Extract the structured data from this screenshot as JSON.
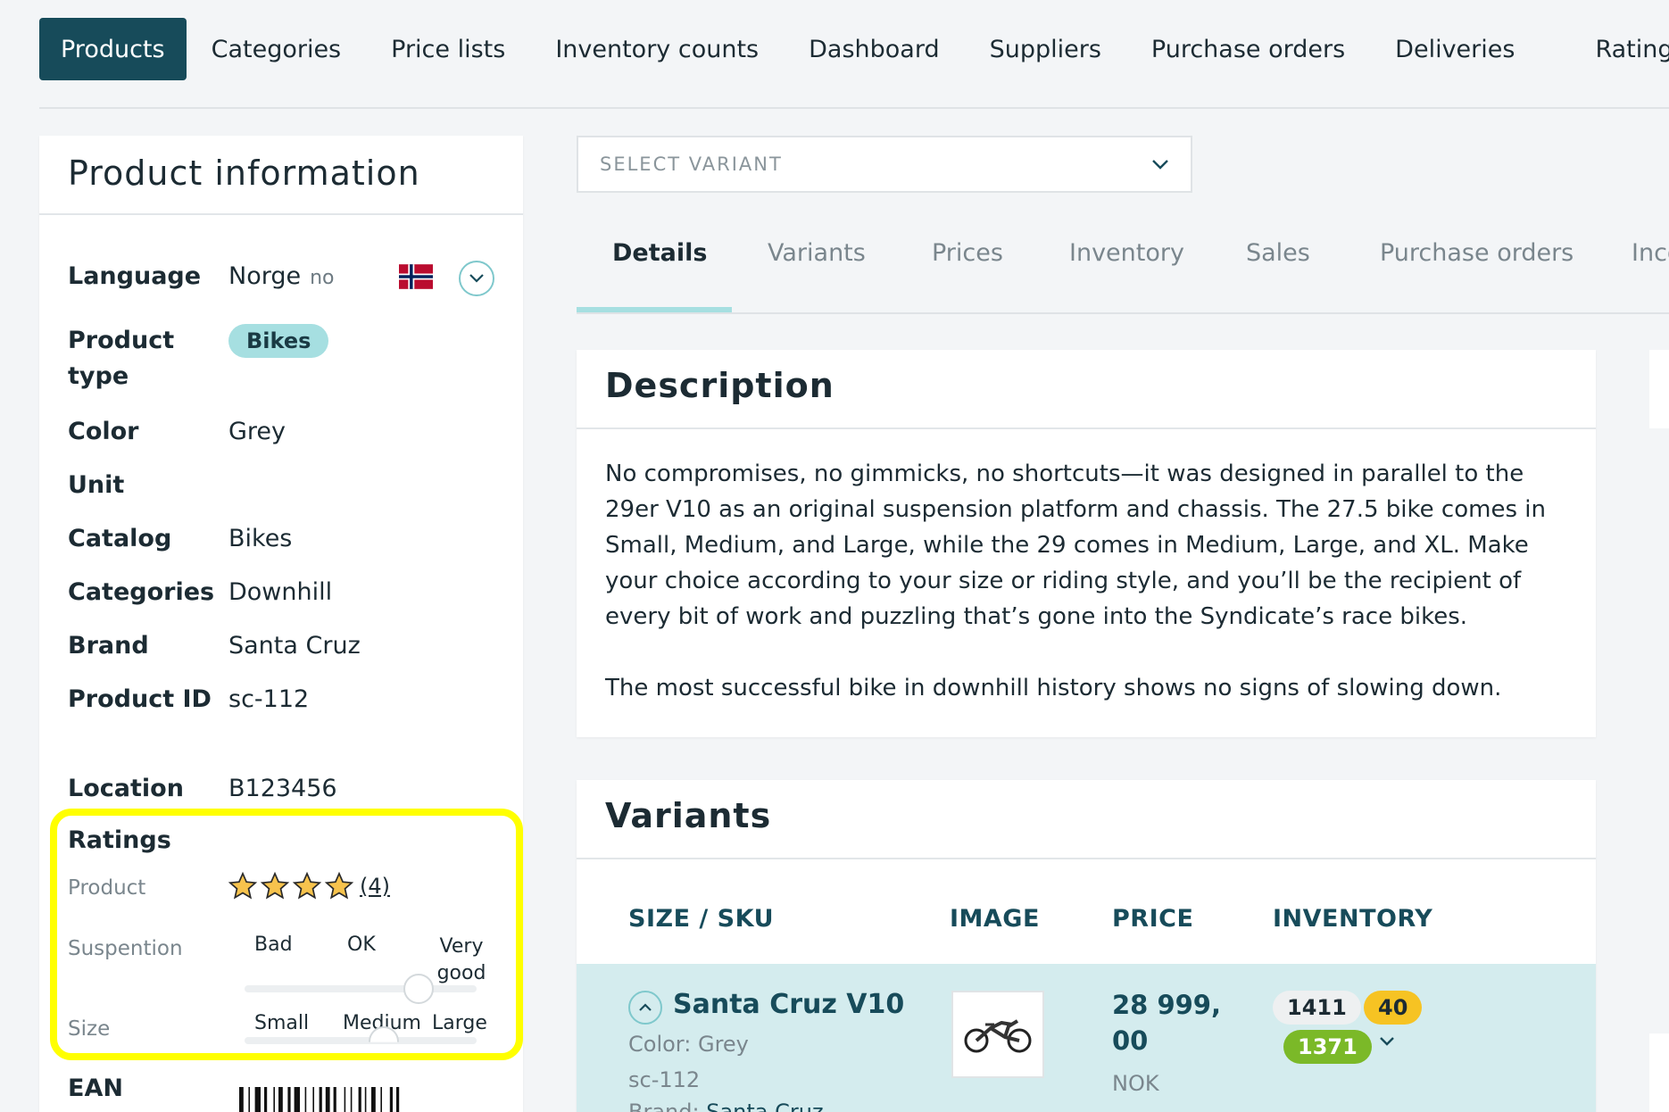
{
  "nav": {
    "items": [
      "Products",
      "Categories",
      "Price lists",
      "Inventory counts",
      "Dashboard",
      "Suppliers",
      "Purchase orders",
      "Deliveries",
      "Ratings"
    ],
    "active": "Products"
  },
  "product_info": {
    "title": "Product information",
    "language": {
      "label": "Language",
      "value": "Norge",
      "code": "no"
    },
    "product_type": {
      "label": "Product type",
      "value": "Bikes"
    },
    "color": {
      "label": "Color",
      "value": "Grey"
    },
    "unit": {
      "label": "Unit",
      "value": ""
    },
    "catalog": {
      "label": "Catalog",
      "value": "Bikes"
    },
    "categories": {
      "label": "Categories",
      "value": "Downhill"
    },
    "brand": {
      "label": "Brand",
      "value": "Santa Cruz"
    },
    "product_id": {
      "label": "Product ID",
      "value": "sc-112"
    },
    "location": {
      "label": "Location",
      "value": "B123456"
    },
    "ratings": {
      "title": "Ratings",
      "product": {
        "label": "Product",
        "stars": 4,
        "count_text": "(4)"
      },
      "suspension": {
        "label": "Suspention",
        "scale": [
          "Bad",
          "OK",
          "Very good"
        ],
        "level": 0.75
      },
      "size": {
        "label": "Size",
        "scale": [
          "Small",
          "Medium",
          "Large"
        ],
        "level": 0.6
      }
    },
    "ean": {
      "label": "EAN"
    }
  },
  "variant_select": {
    "placeholder": "SELECT VARIANT"
  },
  "tabs": [
    "Details",
    "Variants",
    "Prices",
    "Inventory",
    "Sales",
    "Purchase orders",
    "Inco"
  ],
  "description": {
    "title": "Description",
    "paragraphs": [
      "No compromises, no gimmicks, no shortcuts—it was designed in parallel to the 29er V10 as an original suspension platform and chassis. The 27.5 bike comes in Small, Medium, and Large, while the 29 comes in Medium, Large, and XL. Make your choice according to your size or riding style, and you’ll be the recipient of every bit of work and puzzling that’s gone into the Syndicate’s race bikes.",
      "The most successful bike in downhill history shows no signs of slowing down."
    ]
  },
  "variants": {
    "title": "Variants",
    "columns": [
      "SIZE / SKU",
      "IMAGE",
      "PRICE",
      "INVENTORY"
    ],
    "row": {
      "name": "Santa Cruz V10",
      "color_label": "Color:",
      "color": "Grey",
      "sku": "sc-112",
      "brand_label": "Brand:",
      "brand": "Santa Cruz",
      "price": "28 999,00",
      "currency": "NOK",
      "inventory_total": "1411",
      "inventory_reserved": "40",
      "inventory_available": "1371"
    }
  },
  "colors": {
    "primary": "#174b5a",
    "accent": "#a6dfe1",
    "highlight": "#ffff00",
    "warning": "#f6c323",
    "success": "#7bb928"
  }
}
